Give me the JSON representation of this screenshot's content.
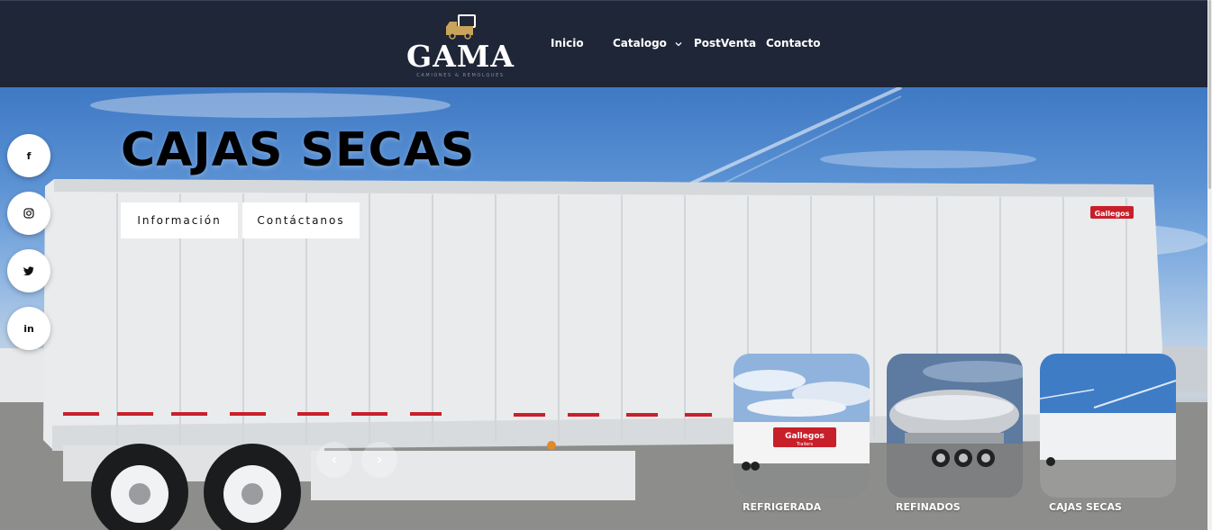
{
  "brand": {
    "name": "GAMA",
    "tagline": "CAMIONES & REMOLQUES"
  },
  "nav": {
    "items": [
      {
        "label": "Inicio"
      },
      {
        "label": "Catalogo"
      },
      {
        "label": "PostVenta"
      },
      {
        "label": "Contacto"
      }
    ]
  },
  "hero": {
    "title": "CAJAS SECAS",
    "trailer_brand": "Gallegos",
    "buttons": [
      {
        "label": "Información"
      },
      {
        "label": "Contáctanos"
      }
    ]
  },
  "social": [
    {
      "label": "f",
      "icon": "facebook-icon"
    },
    {
      "label": "",
      "icon": "instagram-icon"
    },
    {
      "label": "",
      "icon": "twitter-icon"
    },
    {
      "label": "in",
      "icon": "linkedin-icon"
    }
  ],
  "slider": {
    "thumbnails": [
      {
        "label": "REFRIGERADA",
        "sign": "Gallegos",
        "sign_sub": "Trailers"
      },
      {
        "label": "REFINADOS"
      },
      {
        "label": "CAJAS SECAS"
      }
    ]
  },
  "colors": {
    "header_bg": "#1f2637",
    "logo_gold": "#c9a35a",
    "accent_red": "#c8202a"
  }
}
